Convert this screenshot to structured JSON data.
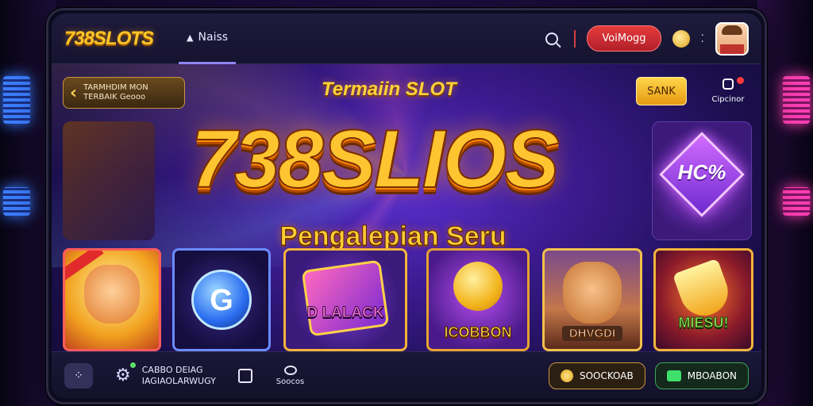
{
  "header": {
    "logo": "738SLOTS",
    "nav_tab": "Naiss",
    "login_label": "VoiMogg"
  },
  "promo": {
    "back_line1": "TARMHDIM MON",
    "back_line2": "TERBAIK Geooo",
    "title": "Termaiin SLOT",
    "rank_label": "SANK",
    "gift_label": "Cipcinor"
  },
  "hero": {
    "title": "738SLIOS",
    "subtitle": "Pengalepian Seru",
    "side_badge": "HC%"
  },
  "games": [
    {
      "label": ""
    },
    {
      "label": "G"
    },
    {
      "label": "D LALACK"
    },
    {
      "label": "ICOBBON"
    },
    {
      "label": "DHVGDI"
    },
    {
      "label": "MIESU!"
    }
  ],
  "footer": {
    "text_line1": "CABBO DEIAG",
    "text_line2": "IAGIAOLARWUGY",
    "chat_label": "Soocos",
    "deposit_label": "SOOCKOAB",
    "chat_button_label": "MBOABON"
  },
  "colors": {
    "accent_gold": "#ffc530",
    "login_red": "#e43b3b",
    "chat_green": "#3ee06a",
    "background_purple": "#3a1a8c"
  }
}
